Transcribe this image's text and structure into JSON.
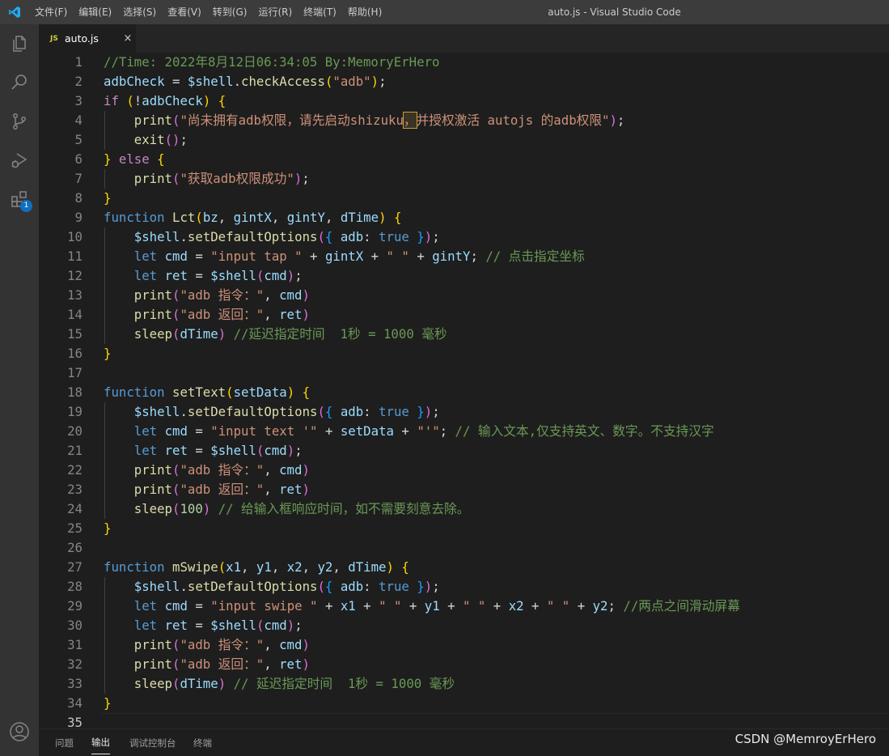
{
  "titlebar": {
    "menu": [
      "文件(F)",
      "编辑(E)",
      "选择(S)",
      "查看(V)",
      "转到(G)",
      "运行(R)",
      "终端(T)",
      "帮助(H)"
    ],
    "window_title": "auto.js - Visual Studio Code"
  },
  "activitybar": {
    "icons": [
      "files-icon",
      "search-icon",
      "source-control-icon",
      "run-debug-icon",
      "extensions-icon"
    ],
    "extensions_badge": "1",
    "account_icon": "account-icon"
  },
  "tab": {
    "icon": "JS",
    "label": "auto.js",
    "close": "×"
  },
  "editor": {
    "line_numbers": [
      "1",
      "2",
      "3",
      "4",
      "5",
      "6",
      "7",
      "8",
      "9",
      "10",
      "11",
      "12",
      "13",
      "14",
      "15",
      "16",
      "17",
      "18",
      "19",
      "20",
      "21",
      "22",
      "23",
      "24",
      "25",
      "26",
      "27",
      "28",
      "29",
      "30",
      "31",
      "32",
      "33",
      "34",
      "35"
    ],
    "lines": [
      [
        [
          "c",
          "//Time: 2022年8月12日06:34:05 By:MemoryErHero"
        ]
      ],
      [
        [
          "v",
          "adbCheck"
        ],
        [
          "d",
          " = "
        ],
        [
          "v",
          "$shell"
        ],
        [
          "d",
          "."
        ],
        [
          "f",
          "checkAccess"
        ],
        [
          "b1",
          "("
        ],
        [
          "s",
          "\"adb\""
        ],
        [
          "b1",
          ")"
        ],
        [
          "d",
          ";"
        ]
      ],
      [
        [
          "k",
          "if"
        ],
        [
          "d",
          " "
        ],
        [
          "b1",
          "("
        ],
        [
          "d",
          "!"
        ],
        [
          "v",
          "adbCheck"
        ],
        [
          "b1",
          ")"
        ],
        [
          "d",
          " "
        ],
        [
          "b1",
          "{"
        ]
      ],
      [
        [
          "d",
          "    "
        ],
        [
          "f",
          "print"
        ],
        [
          "b2",
          "("
        ],
        [
          "s",
          "\"尚未拥有adb权限，请先启动shizuku"
        ],
        [
          "hl",
          "，"
        ],
        [
          "s",
          "并授权激活 autojs 的adb权限\""
        ],
        [
          "b2",
          ")"
        ],
        [
          "d",
          ";"
        ]
      ],
      [
        [
          "d",
          "    "
        ],
        [
          "f",
          "exit"
        ],
        [
          "b2",
          "()"
        ],
        [
          "d",
          ";"
        ]
      ],
      [
        [
          "b1",
          "}"
        ],
        [
          "d",
          " "
        ],
        [
          "k",
          "else"
        ],
        [
          "d",
          " "
        ],
        [
          "b1",
          "{"
        ]
      ],
      [
        [
          "d",
          "    "
        ],
        [
          "f",
          "print"
        ],
        [
          "b2",
          "("
        ],
        [
          "s",
          "\"获取adb权限成功\""
        ],
        [
          "b2",
          ")"
        ],
        [
          "d",
          ";"
        ]
      ],
      [
        [
          "b1",
          "}"
        ]
      ],
      [
        [
          "kb",
          "function"
        ],
        [
          "d",
          " "
        ],
        [
          "f",
          "Lct"
        ],
        [
          "b1",
          "("
        ],
        [
          "v",
          "bz"
        ],
        [
          "d",
          ", "
        ],
        [
          "v",
          "gintX"
        ],
        [
          "d",
          ", "
        ],
        [
          "v",
          "gintY"
        ],
        [
          "d",
          ", "
        ],
        [
          "v",
          "dTime"
        ],
        [
          "b1",
          ")"
        ],
        [
          "d",
          " "
        ],
        [
          "b1",
          "{"
        ]
      ],
      [
        [
          "d",
          "    "
        ],
        [
          "v",
          "$shell"
        ],
        [
          "d",
          "."
        ],
        [
          "f",
          "setDefaultOptions"
        ],
        [
          "b2",
          "("
        ],
        [
          "b3",
          "{"
        ],
        [
          "d",
          " "
        ],
        [
          "v",
          "adb"
        ],
        [
          "d",
          ": "
        ],
        [
          "kb",
          "true"
        ],
        [
          "d",
          " "
        ],
        [
          "b3",
          "}"
        ],
        [
          "b2",
          ")"
        ],
        [
          "d",
          ";"
        ]
      ],
      [
        [
          "d",
          "    "
        ],
        [
          "kb",
          "let"
        ],
        [
          "d",
          " "
        ],
        [
          "v",
          "cmd"
        ],
        [
          "d",
          " = "
        ],
        [
          "s",
          "\"input tap \""
        ],
        [
          "d",
          " + "
        ],
        [
          "v",
          "gintX"
        ],
        [
          "d",
          " + "
        ],
        [
          "s",
          "\" \""
        ],
        [
          "d",
          " + "
        ],
        [
          "v",
          "gintY"
        ],
        [
          "d",
          "; "
        ],
        [
          "c",
          "// 点击指定坐标"
        ]
      ],
      [
        [
          "d",
          "    "
        ],
        [
          "kb",
          "let"
        ],
        [
          "d",
          " "
        ],
        [
          "v",
          "ret"
        ],
        [
          "d",
          " = "
        ],
        [
          "v",
          "$shell"
        ],
        [
          "b2",
          "("
        ],
        [
          "v",
          "cmd"
        ],
        [
          "b2",
          ")"
        ],
        [
          "d",
          ";"
        ]
      ],
      [
        [
          "d",
          "    "
        ],
        [
          "f",
          "print"
        ],
        [
          "b2",
          "("
        ],
        [
          "s",
          "\"adb 指令：\""
        ],
        [
          "d",
          ", "
        ],
        [
          "v",
          "cmd"
        ],
        [
          "b2",
          ")"
        ]
      ],
      [
        [
          "d",
          "    "
        ],
        [
          "f",
          "print"
        ],
        [
          "b2",
          "("
        ],
        [
          "s",
          "\"adb 返回：\""
        ],
        [
          "d",
          ", "
        ],
        [
          "v",
          "ret"
        ],
        [
          "b2",
          ")"
        ]
      ],
      [
        [
          "d",
          "    "
        ],
        [
          "f",
          "sleep"
        ],
        [
          "b2",
          "("
        ],
        [
          "v",
          "dTime"
        ],
        [
          "b2",
          ")"
        ],
        [
          "d",
          " "
        ],
        [
          "c",
          "//延迟指定时间  1秒 = 1000 毫秒"
        ]
      ],
      [
        [
          "b1",
          "}"
        ]
      ],
      [],
      [
        [
          "kb",
          "function"
        ],
        [
          "d",
          " "
        ],
        [
          "f",
          "setText"
        ],
        [
          "b1",
          "("
        ],
        [
          "v",
          "setData"
        ],
        [
          "b1",
          ")"
        ],
        [
          "d",
          " "
        ],
        [
          "b1",
          "{"
        ]
      ],
      [
        [
          "d",
          "    "
        ],
        [
          "v",
          "$shell"
        ],
        [
          "d",
          "."
        ],
        [
          "f",
          "setDefaultOptions"
        ],
        [
          "b2",
          "("
        ],
        [
          "b3",
          "{"
        ],
        [
          "d",
          " "
        ],
        [
          "v",
          "adb"
        ],
        [
          "d",
          ": "
        ],
        [
          "kb",
          "true"
        ],
        [
          "d",
          " "
        ],
        [
          "b3",
          "}"
        ],
        [
          "b2",
          ")"
        ],
        [
          "d",
          ";"
        ]
      ],
      [
        [
          "d",
          "    "
        ],
        [
          "kb",
          "let"
        ],
        [
          "d",
          " "
        ],
        [
          "v",
          "cmd"
        ],
        [
          "d",
          " = "
        ],
        [
          "s",
          "\"input text '\""
        ],
        [
          "d",
          " + "
        ],
        [
          "v",
          "setData"
        ],
        [
          "d",
          " + "
        ],
        [
          "s",
          "\"'\""
        ],
        [
          "d",
          "; "
        ],
        [
          "c",
          "// 输入文本,仅支持英文、数字。不支持汉字"
        ]
      ],
      [
        [
          "d",
          "    "
        ],
        [
          "kb",
          "let"
        ],
        [
          "d",
          " "
        ],
        [
          "v",
          "ret"
        ],
        [
          "d",
          " = "
        ],
        [
          "v",
          "$shell"
        ],
        [
          "b2",
          "("
        ],
        [
          "v",
          "cmd"
        ],
        [
          "b2",
          ")"
        ],
        [
          "d",
          ";"
        ]
      ],
      [
        [
          "d",
          "    "
        ],
        [
          "f",
          "print"
        ],
        [
          "b2",
          "("
        ],
        [
          "s",
          "\"adb 指令：\""
        ],
        [
          "d",
          ", "
        ],
        [
          "v",
          "cmd"
        ],
        [
          "b2",
          ")"
        ]
      ],
      [
        [
          "d",
          "    "
        ],
        [
          "f",
          "print"
        ],
        [
          "b2",
          "("
        ],
        [
          "s",
          "\"adb 返回：\""
        ],
        [
          "d",
          ", "
        ],
        [
          "v",
          "ret"
        ],
        [
          "b2",
          ")"
        ]
      ],
      [
        [
          "d",
          "    "
        ],
        [
          "f",
          "sleep"
        ],
        [
          "b2",
          "("
        ],
        [
          "n",
          "100"
        ],
        [
          "b2",
          ")"
        ],
        [
          "d",
          " "
        ],
        [
          "c",
          "// 给输入框响应时间，如不需要刻意去除。"
        ]
      ],
      [
        [
          "b1",
          "}"
        ]
      ],
      [],
      [
        [
          "kb",
          "function"
        ],
        [
          "d",
          " "
        ],
        [
          "f",
          "mSwipe"
        ],
        [
          "b1",
          "("
        ],
        [
          "v",
          "x1"
        ],
        [
          "d",
          ", "
        ],
        [
          "v",
          "y1"
        ],
        [
          "d",
          ", "
        ],
        [
          "v",
          "x2"
        ],
        [
          "d",
          ", "
        ],
        [
          "v",
          "y2"
        ],
        [
          "d",
          ", "
        ],
        [
          "v",
          "dTime"
        ],
        [
          "b1",
          ")"
        ],
        [
          "d",
          " "
        ],
        [
          "b1",
          "{"
        ]
      ],
      [
        [
          "d",
          "    "
        ],
        [
          "v",
          "$shell"
        ],
        [
          "d",
          "."
        ],
        [
          "f",
          "setDefaultOptions"
        ],
        [
          "b2",
          "("
        ],
        [
          "b3",
          "{"
        ],
        [
          "d",
          " "
        ],
        [
          "v",
          "adb"
        ],
        [
          "d",
          ": "
        ],
        [
          "kb",
          "true"
        ],
        [
          "d",
          " "
        ],
        [
          "b3",
          "}"
        ],
        [
          "b2",
          ")"
        ],
        [
          "d",
          ";"
        ]
      ],
      [
        [
          "d",
          "    "
        ],
        [
          "kb",
          "let"
        ],
        [
          "d",
          " "
        ],
        [
          "v",
          "cmd"
        ],
        [
          "d",
          " = "
        ],
        [
          "s",
          "\"input swipe \""
        ],
        [
          "d",
          " + "
        ],
        [
          "v",
          "x1"
        ],
        [
          "d",
          " + "
        ],
        [
          "s",
          "\" \""
        ],
        [
          "d",
          " + "
        ],
        [
          "v",
          "y1"
        ],
        [
          "d",
          " + "
        ],
        [
          "s",
          "\" \""
        ],
        [
          "d",
          " + "
        ],
        [
          "v",
          "x2"
        ],
        [
          "d",
          " + "
        ],
        [
          "s",
          "\" \""
        ],
        [
          "d",
          " + "
        ],
        [
          "v",
          "y2"
        ],
        [
          "d",
          "; "
        ],
        [
          "c",
          "//两点之间滑动屏幕"
        ]
      ],
      [
        [
          "d",
          "    "
        ],
        [
          "kb",
          "let"
        ],
        [
          "d",
          " "
        ],
        [
          "v",
          "ret"
        ],
        [
          "d",
          " = "
        ],
        [
          "v",
          "$shell"
        ],
        [
          "b2",
          "("
        ],
        [
          "v",
          "cmd"
        ],
        [
          "b2",
          ")"
        ],
        [
          "d",
          ";"
        ]
      ],
      [
        [
          "d",
          "    "
        ],
        [
          "f",
          "print"
        ],
        [
          "b2",
          "("
        ],
        [
          "s",
          "\"adb 指令：\""
        ],
        [
          "d",
          ", "
        ],
        [
          "v",
          "cmd"
        ],
        [
          "b2",
          ")"
        ]
      ],
      [
        [
          "d",
          "    "
        ],
        [
          "f",
          "print"
        ],
        [
          "b2",
          "("
        ],
        [
          "s",
          "\"adb 返回：\""
        ],
        [
          "d",
          ", "
        ],
        [
          "v",
          "ret"
        ],
        [
          "b2",
          ")"
        ]
      ],
      [
        [
          "d",
          "    "
        ],
        [
          "f",
          "sleep"
        ],
        [
          "b2",
          "("
        ],
        [
          "v",
          "dTime"
        ],
        [
          "b2",
          ")"
        ],
        [
          "d",
          " "
        ],
        [
          "c",
          "// 延迟指定时间  1秒 = 1000 毫秒"
        ]
      ],
      [
        [
          "b1",
          "}"
        ]
      ],
      []
    ]
  },
  "panel": {
    "tabs": [
      "问题",
      "输出",
      "调试控制台",
      "终端"
    ],
    "active_tab": "输出"
  },
  "watermark": "CSDN @MemroyErHero",
  "colors": {
    "accent": "#0e70c0",
    "comment": "#6a9955",
    "string": "#ce9178",
    "function": "#dcdcaa",
    "variable": "#9cdcfe",
    "keyword": "#569cd6",
    "control": "#c586c0"
  }
}
